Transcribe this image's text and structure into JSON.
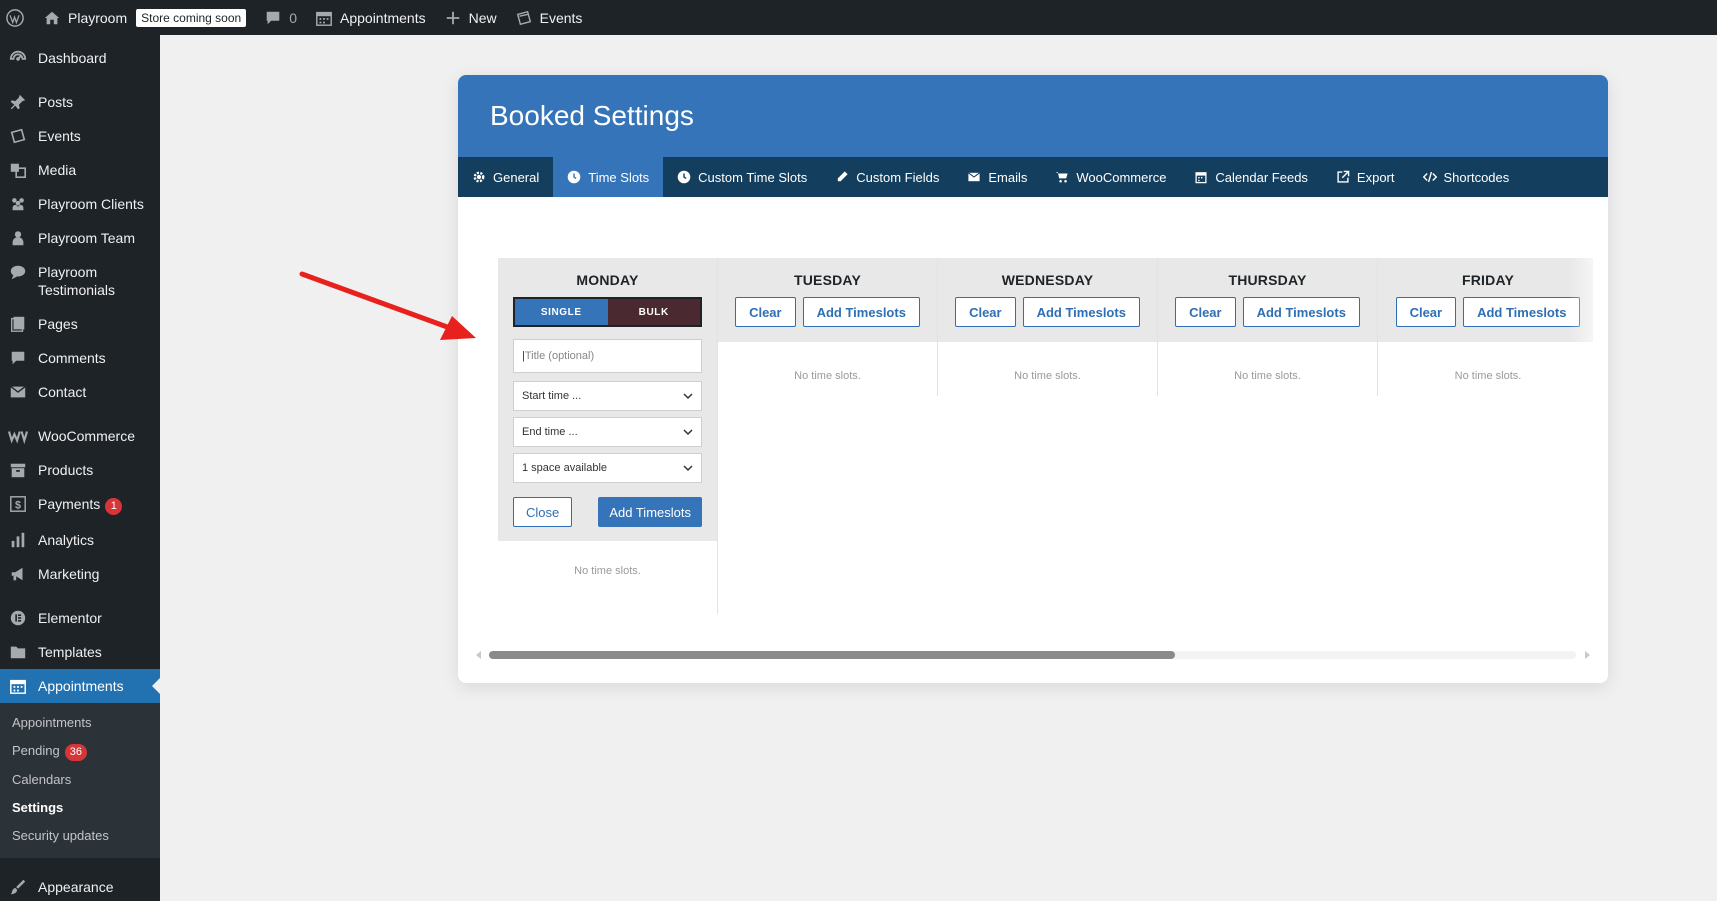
{
  "adminbar": {
    "site_name": "Playroom",
    "store_badge": "Store coming soon",
    "comments_count": "0",
    "appointments": "Appointments",
    "new": "New",
    "events": "Events"
  },
  "sidebar": {
    "items": [
      {
        "label": "Dashboard",
        "icon": "dashboard-icon"
      },
      {
        "label": "Posts",
        "icon": "pin-icon"
      },
      {
        "label": "Events",
        "icon": "events-icon"
      },
      {
        "label": "Media",
        "icon": "media-icon"
      },
      {
        "label": "Playroom Clients",
        "icon": "groups-icon"
      },
      {
        "label": "Playroom Team",
        "icon": "person-icon"
      },
      {
        "label": "Playroom Testimonials",
        "icon": "chat-icon"
      },
      {
        "label": "Pages",
        "icon": "pages-icon"
      },
      {
        "label": "Comments",
        "icon": "comment-icon"
      },
      {
        "label": "Contact",
        "icon": "mail-icon"
      },
      {
        "label": "WooCommerce",
        "icon": "woo-icon"
      },
      {
        "label": "Products",
        "icon": "archive-icon"
      },
      {
        "label": "Payments",
        "icon": "dollar-icon",
        "badge": "1"
      },
      {
        "label": "Analytics",
        "icon": "bar-chart-icon"
      },
      {
        "label": "Marketing",
        "icon": "megaphone-icon"
      },
      {
        "label": "Elementor",
        "icon": "elementor-icon"
      },
      {
        "label": "Templates",
        "icon": "folder-icon"
      },
      {
        "label": "Appointments",
        "icon": "calendar-icon"
      },
      {
        "label": "Appearance",
        "icon": "brush-icon"
      }
    ],
    "submenu": [
      {
        "label": "Appointments"
      },
      {
        "label": "Pending",
        "badge": "36"
      },
      {
        "label": "Calendars"
      },
      {
        "label": "Settings"
      },
      {
        "label": "Security updates"
      }
    ]
  },
  "panel": {
    "title": "Booked Settings",
    "tabs": [
      {
        "label": "General",
        "icon": "gear-icon"
      },
      {
        "label": "Time Slots",
        "icon": "clock-icon"
      },
      {
        "label": "Custom Time Slots",
        "icon": "clock-icon"
      },
      {
        "label": "Custom Fields",
        "icon": "pencil-icon"
      },
      {
        "label": "Emails",
        "icon": "envelope-icon"
      },
      {
        "label": "WooCommerce",
        "icon": "cart-icon"
      },
      {
        "label": "Calendar Feeds",
        "icon": "calendar-icon"
      },
      {
        "label": "Export",
        "icon": "external-link-icon"
      },
      {
        "label": "Shortcodes",
        "icon": "code-icon"
      }
    ]
  },
  "timeslots": {
    "monday": {
      "name": "MONDAY",
      "toggle_single": "SINGLE",
      "toggle_bulk": "BULK",
      "title_placeholder": "Title (optional)",
      "start_time": "Start time ...",
      "end_time": "End time ...",
      "spaces": "1 space available",
      "close_label": "Close",
      "add_label": "Add Timeslots",
      "empty": "No time slots."
    },
    "days": [
      {
        "name": "TUESDAY",
        "clear": "Clear",
        "add": "Add Timeslots",
        "empty": "No time slots."
      },
      {
        "name": "WEDNESDAY",
        "clear": "Clear",
        "add": "Add Timeslots",
        "empty": "No time slots."
      },
      {
        "name": "THURSDAY",
        "clear": "Clear",
        "add": "Add Timeslots",
        "empty": "No time slots."
      },
      {
        "name": "FRIDAY",
        "clear": "Clear",
        "add": "Add Timeslots",
        "empty": "No time slots."
      }
    ]
  },
  "colors": {
    "admin_dark": "#1d2327",
    "accent_blue": "#3574b8",
    "tabs_dark": "#143e5d",
    "annotation_red": "#e8211e"
  }
}
